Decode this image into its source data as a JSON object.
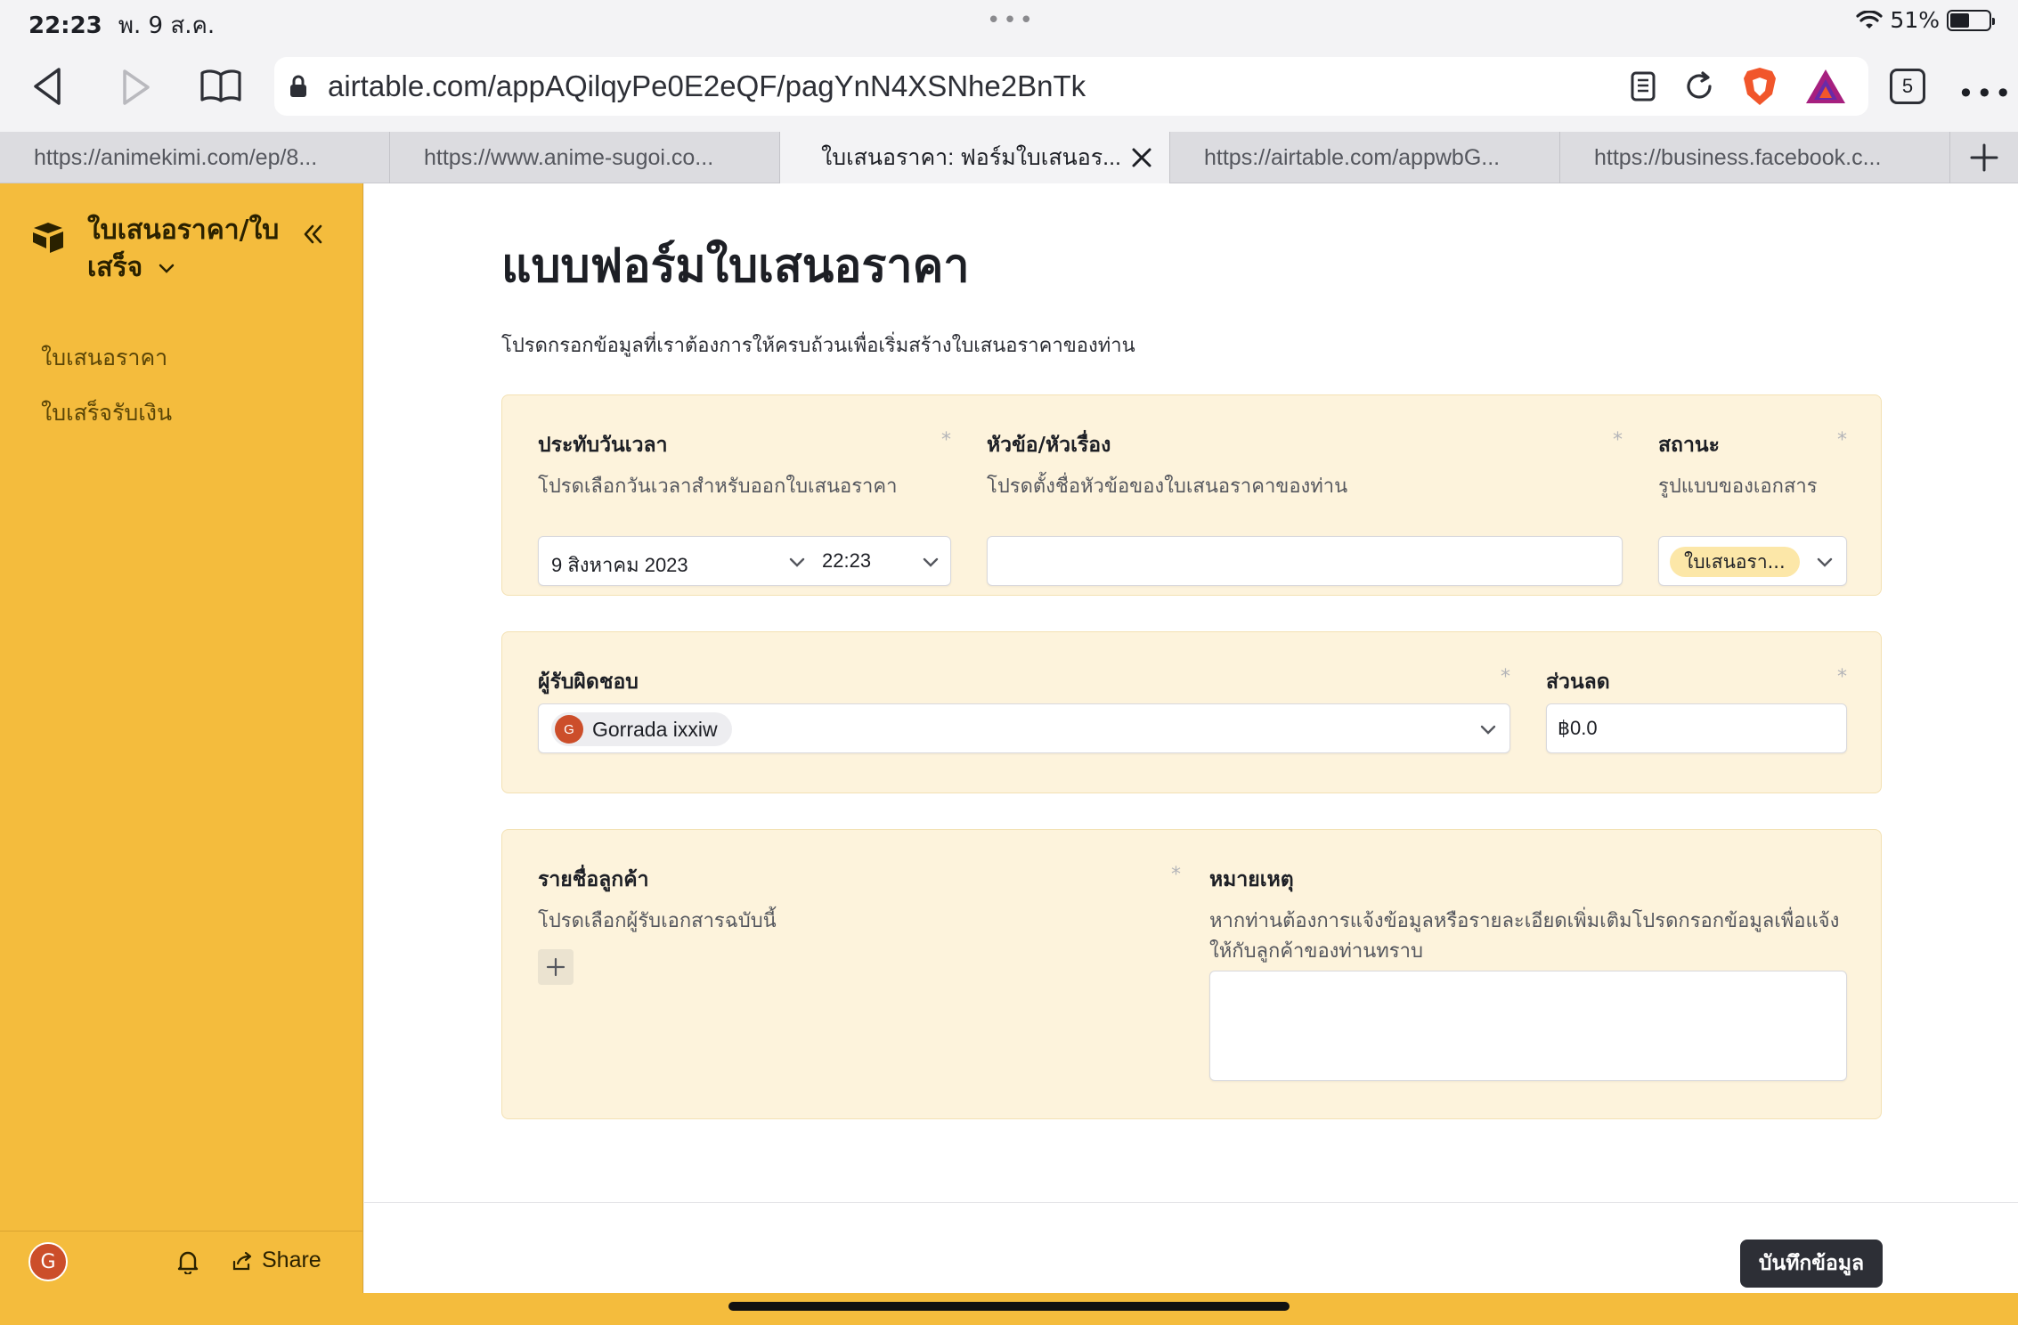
{
  "status_bar": {
    "time": "22:23",
    "date": "พ. 9 ส.ค.",
    "dots": "•••",
    "battery": "51%"
  },
  "browser": {
    "url": "airtable.com/appAQilqyPe0E2eQF/pagYnN4XSNhe2BnTk",
    "tab_count": "5",
    "tabs": [
      {
        "label": "https://animekimi.com/ep/8..."
      },
      {
        "label": "https://www.anime-sugoi.co..."
      },
      {
        "label": "ใบเสนอราคา: ฟอร์มใบเสนอร..."
      },
      {
        "label": "https://airtable.com/appwbG..."
      },
      {
        "label": "https://business.facebook.c..."
      }
    ]
  },
  "sidebar": {
    "base_name": "ใบเสนอราคา/ใบเสร็จ",
    "items": [
      {
        "label": "ใบเสนอราคา"
      },
      {
        "label": "ใบเสร็จรับเงิน"
      }
    ],
    "avatar_initial": "G",
    "share_label": "Share"
  },
  "form": {
    "title": "แบบฟอร์มใบเสนอราคา",
    "description": "โปรดกรอกข้อมูลที่เราต้องการให้ครบถ้วนเพื่อเริ่มสร้างใบเสนอราคาของท่าน",
    "required_mark": "*",
    "date_field": {
      "label": "ประทับวันเวลา",
      "help": "โปรดเลือกวันเวลาสำหรับออกใบเสนอราคา",
      "date_value": "9 สิงหาคม 2023",
      "time_value": "22:23"
    },
    "subject_field": {
      "label": "หัวข้อ/หัวเรื่อง",
      "help": "โปรดตั้งชื่อหัวข้อของใบเสนอราคาของท่าน",
      "value": ""
    },
    "status_field": {
      "label": "สถานะ",
      "help": "รูปแบบของเอกสาร",
      "value": "ใบเสนอรา..."
    },
    "owner_field": {
      "label": "ผู้รับผิดชอบ",
      "user_initial": "G",
      "user_name": "Gorrada ixxiw"
    },
    "discount_field": {
      "label": "ส่วนลด",
      "value": "฿0.0"
    },
    "customer_field": {
      "label": "รายชื่อลูกค้า",
      "help": "โปรดเลือกผู้รับเอกสารฉบับนี้"
    },
    "note_field": {
      "label": "หมายเหตุ",
      "help": "หากท่านต้องการแจ้งข้อมูลหรือรายละเอียดเพิ่มเติมโปรดกรอกข้อมูลเพื่อแจ้งให้กับลูกค้าของท่านทราบ",
      "value": ""
    },
    "submit_label": "บันทึกข้อมูล"
  },
  "colors": {
    "sidebar": "#f4bc3d",
    "card": "#fdf3dc",
    "status_pill": "#fce7a8",
    "avatar": "#cc4e2a",
    "submit": "#2d2f36"
  }
}
